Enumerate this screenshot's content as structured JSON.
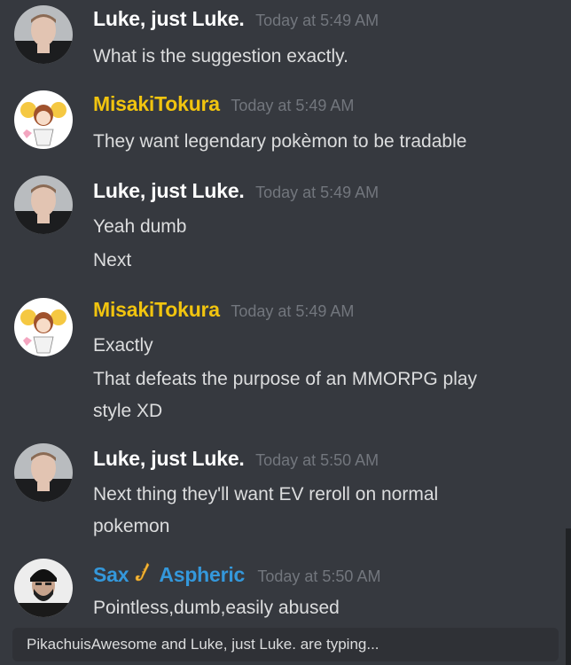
{
  "colors": {
    "background": "#36393f",
    "text": "#dcddde",
    "timestamp": "#72767d",
    "luke_name": "#ffffff",
    "misaki_name": "#f1c40f",
    "sax_name": "#3498db",
    "typing_bar": "#2f3136"
  },
  "messages": [
    {
      "author": "Luke, just Luke.",
      "timestamp": "Today at 5:49 AM",
      "lines": [
        "What is the suggestion exactly."
      ]
    },
    {
      "author": "MisakiTokura",
      "timestamp": "Today at 5:49 AM",
      "lines": [
        "They want legendary pokèmon to be tradable"
      ]
    },
    {
      "author": "Luke, just Luke.",
      "timestamp": "Today at 5:49 AM",
      "lines": [
        "Yeah dumb",
        "Next"
      ]
    },
    {
      "author": "MisakiTokura",
      "timestamp": "Today at 5:49 AM",
      "lines": [
        "Exactly",
        "That defeats the purpose of an MMORPG play",
        "style XD"
      ]
    },
    {
      "author": "Luke, just Luke.",
      "timestamp": "Today at 5:50 AM",
      "lines": [
        "Next thing they'll want EV reroll on normal",
        "pokemon"
      ]
    },
    {
      "author_part1": "Sax",
      "author_part2": "Aspheric",
      "author_icon": "saxophone-icon",
      "timestamp": "Today at 5:50 AM",
      "lines": [
        "Pointless,dumb,easily abused"
      ]
    }
  ],
  "typing_indicator": "PikachuisAwesome and Luke, just Luke. are typing..."
}
